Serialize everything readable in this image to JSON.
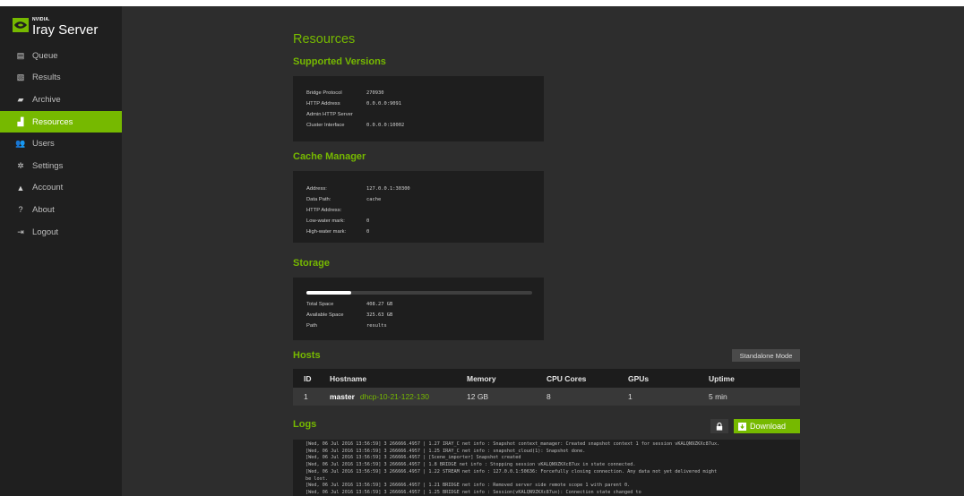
{
  "app": {
    "brand_small": "NVIDIA.",
    "brand_big": "Iray Server",
    "accent_color": "#76b900"
  },
  "sidebar": {
    "items": [
      {
        "label": "Queue",
        "icon": "queue-icon",
        "glyph": "▤"
      },
      {
        "label": "Results",
        "icon": "image-icon",
        "glyph": "▧"
      },
      {
        "label": "Archive",
        "icon": "archive-icon",
        "glyph": "▰"
      },
      {
        "label": "Resources",
        "icon": "chart-icon",
        "glyph": "▟"
      },
      {
        "label": "Users",
        "icon": "users-icon",
        "glyph": "👥"
      },
      {
        "label": "Settings",
        "icon": "gear-icon",
        "glyph": "✲"
      },
      {
        "label": "Account",
        "icon": "user-icon",
        "glyph": "▲"
      },
      {
        "label": "About",
        "icon": "question-icon",
        "glyph": "?"
      },
      {
        "label": "Logout",
        "icon": "logout-icon",
        "glyph": "⇥"
      }
    ],
    "active": "Resources"
  },
  "page": {
    "title": "Resources"
  },
  "supported_versions": {
    "heading": "Supported Versions",
    "rows": [
      {
        "key": "Bridge Protocol",
        "value": "270930"
      },
      {
        "key": "HTTP Address",
        "value": "0.0.0.0:9091"
      },
      {
        "key": "Admin HTTP Server",
        "value": ""
      },
      {
        "key": "Cluster Interface",
        "value": "0.0.0.0:10002"
      }
    ]
  },
  "cache_manager": {
    "heading": "Cache Manager",
    "rows": [
      {
        "key": "Address:",
        "value": "127.0.0.1:30300"
      },
      {
        "key": "Data Path:",
        "value": "cache"
      },
      {
        "key": "HTTP Address:",
        "value": ""
      },
      {
        "key": "Low-water mark:",
        "value": "0"
      },
      {
        "key": "High-water mark:",
        "value": "0"
      }
    ]
  },
  "storage": {
    "heading": "Storage",
    "used_fraction": 0.2,
    "rows": [
      {
        "key": "Total Space",
        "value": "408.27 GB"
      },
      {
        "key": "Available Space",
        "value": "325.63 GB"
      },
      {
        "key": "Path",
        "value": "results"
      }
    ]
  },
  "hosts": {
    "heading": "Hosts",
    "mode_button": "Standalone Mode",
    "columns": [
      "ID",
      "Hostname",
      "Memory",
      "CPU Cores",
      "GPUs",
      "Uptime"
    ],
    "rows": [
      {
        "id": "1",
        "name": "master",
        "host": "dhcp-10-21-122-130",
        "memory": "12 GB",
        "cpu": "8",
        "gpus": "1",
        "uptime": "5 min"
      }
    ]
  },
  "logs": {
    "heading": "Logs",
    "download_label": "Download",
    "lines": [
      "[Wed, 06 Jul 2016 13:56:59] 3 266666.4957 | 1.27 IRAY_C net info : Snapshot context_manager: Created snapshot context 1 for session vKALQN9ZKXc87ux.",
      "[Wed, 06 Jul 2016 13:56:59] 3 266666.4957 | 1.25 IRAY_C net info : snapshot_cloud(1): Snapshot done.",
      "[Wed, 06 Jul 2016 13:56:59] 3 266666.4957 | [Scene_importer] Snapshot created",
      "[Wed, 06 Jul 2016 13:56:59] 3 266666.4957 | 1.8 BRIDGE net info : Stopping session vKALQN9ZKXc87ux in state connected.",
      "[Wed, 06 Jul 2016 13:56:59] 3 266666.4957 | 1.22 STREAM net info : 127.0.0.1:50636: Forcefully closing connection. Any data not yet delivered might",
      "be lost.",
      "[Wed, 06 Jul 2016 13:56:59] 3 266666.4957 | 1.21 BRIDGE net info : Removed server side remote scope 1 with parent 0.",
      "[Wed, 06 Jul 2016 13:56:59] 3 266666.4957 | 1.25 BRIDGE net info : Session(vKALQN9ZKXc87ux): Connection state changed to"
    ]
  }
}
